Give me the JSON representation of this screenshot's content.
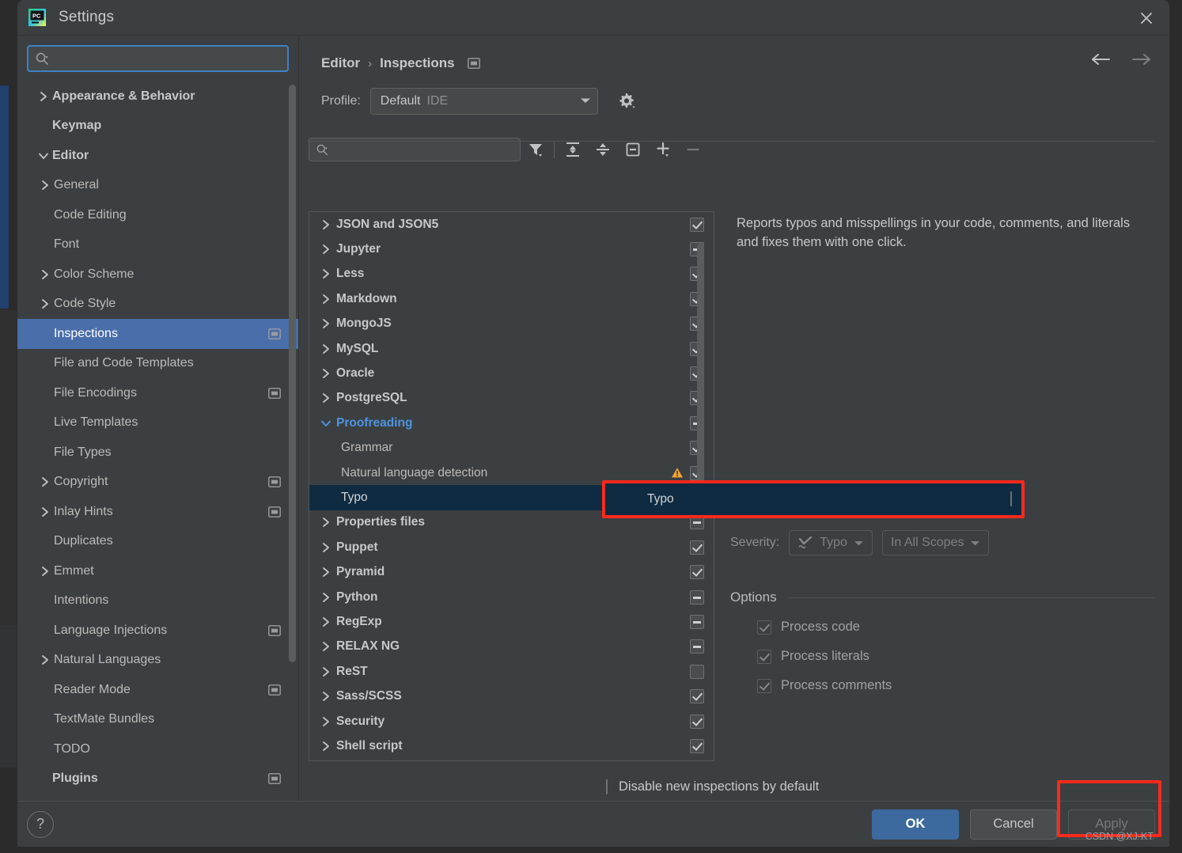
{
  "window": {
    "title": "Settings",
    "logo_icon": "pycharm-logo-icon",
    "close_icon": "close-icon"
  },
  "sidebar": {
    "search": {
      "placeholder": "",
      "value": "",
      "icon": "search-icon"
    },
    "items": [
      {
        "label": "Appearance & Behavior",
        "indent": 0,
        "twisty": "chevron-right",
        "bold": true,
        "selected": false,
        "badge": ""
      },
      {
        "label": "Keymap",
        "indent": 0,
        "twisty": "",
        "bold": true,
        "selected": false,
        "badge": ""
      },
      {
        "label": "Editor",
        "indent": 0,
        "twisty": "chevron-down",
        "bold": true,
        "selected": false,
        "badge": ""
      },
      {
        "label": "General",
        "indent": 1,
        "twisty": "chevron-right",
        "bold": false,
        "selected": false,
        "badge": ""
      },
      {
        "label": "Code Editing",
        "indent": 1,
        "twisty": "",
        "bold": false,
        "selected": false,
        "badge": ""
      },
      {
        "label": "Font",
        "indent": 1,
        "twisty": "",
        "bold": false,
        "selected": false,
        "badge": ""
      },
      {
        "label": "Color Scheme",
        "indent": 1,
        "twisty": "chevron-right",
        "bold": false,
        "selected": false,
        "badge": ""
      },
      {
        "label": "Code Style",
        "indent": 1,
        "twisty": "chevron-right",
        "bold": false,
        "selected": false,
        "badge": ""
      },
      {
        "label": "Inspections",
        "indent": 1,
        "twisty": "",
        "bold": false,
        "selected": true,
        "badge": "project-scope-icon"
      },
      {
        "label": "File and Code Templates",
        "indent": 1,
        "twisty": "",
        "bold": false,
        "selected": false,
        "badge": ""
      },
      {
        "label": "File Encodings",
        "indent": 1,
        "twisty": "",
        "bold": false,
        "selected": false,
        "badge": "project-scope-icon"
      },
      {
        "label": "Live Templates",
        "indent": 1,
        "twisty": "",
        "bold": false,
        "selected": false,
        "badge": ""
      },
      {
        "label": "File Types",
        "indent": 1,
        "twisty": "",
        "bold": false,
        "selected": false,
        "badge": ""
      },
      {
        "label": "Copyright",
        "indent": 1,
        "twisty": "chevron-right",
        "bold": false,
        "selected": false,
        "badge": "project-scope-icon"
      },
      {
        "label": "Inlay Hints",
        "indent": 1,
        "twisty": "chevron-right",
        "bold": false,
        "selected": false,
        "badge": "project-scope-icon"
      },
      {
        "label": "Duplicates",
        "indent": 1,
        "twisty": "",
        "bold": false,
        "selected": false,
        "badge": ""
      },
      {
        "label": "Emmet",
        "indent": 1,
        "twisty": "chevron-right",
        "bold": false,
        "selected": false,
        "badge": ""
      },
      {
        "label": "Intentions",
        "indent": 1,
        "twisty": "",
        "bold": false,
        "selected": false,
        "badge": ""
      },
      {
        "label": "Language Injections",
        "indent": 1,
        "twisty": "",
        "bold": false,
        "selected": false,
        "badge": "project-scope-icon"
      },
      {
        "label": "Natural Languages",
        "indent": 1,
        "twisty": "chevron-right",
        "bold": false,
        "selected": false,
        "badge": ""
      },
      {
        "label": "Reader Mode",
        "indent": 1,
        "twisty": "",
        "bold": false,
        "selected": false,
        "badge": "project-scope-icon"
      },
      {
        "label": "TextMate Bundles",
        "indent": 1,
        "twisty": "",
        "bold": false,
        "selected": false,
        "badge": ""
      },
      {
        "label": "TODO",
        "indent": 1,
        "twisty": "",
        "bold": false,
        "selected": false,
        "badge": ""
      },
      {
        "label": "Plugins",
        "indent": 0,
        "twisty": "",
        "bold": true,
        "selected": false,
        "badge": "project-scope-icon"
      }
    ]
  },
  "main": {
    "breadcrumb": {
      "parent": "Editor",
      "separator": "›",
      "current": "Inspections",
      "badge_icon": "project-scope-icon"
    },
    "nav": {
      "back_icon": "arrow-left-icon",
      "forward_icon": "arrow-right-icon"
    },
    "profile": {
      "label": "Profile:",
      "value": "Default",
      "scope": "IDE",
      "caret_icon": "chevron-down-icon",
      "gear_icon": "gear-icon"
    },
    "toolbar": {
      "search": {
        "placeholder": "",
        "value": "",
        "icon": "search-icon"
      },
      "buttons": [
        {
          "name": "filter-icon",
          "title": "Filter inspections",
          "disabled": false
        },
        {
          "name": "expand-all-icon",
          "title": "Expand All",
          "disabled": false
        },
        {
          "name": "collapse-all-icon",
          "title": "Collapse All",
          "disabled": false
        },
        {
          "name": "reset-icon",
          "title": "Reset to Defaults",
          "disabled": false
        },
        {
          "name": "add-icon",
          "title": "Add",
          "disabled": false
        },
        {
          "name": "remove-icon",
          "title": "Remove",
          "disabled": true
        }
      ]
    },
    "inspection_tree": [
      {
        "label": "JSON and JSON5",
        "level": 0,
        "state": "checked",
        "expanded": false,
        "warning": false,
        "selected": false
      },
      {
        "label": "Jupyter",
        "level": 0,
        "state": "partial",
        "expanded": false,
        "warning": false,
        "selected": false
      },
      {
        "label": "Less",
        "level": 0,
        "state": "checked",
        "expanded": false,
        "warning": false,
        "selected": false
      },
      {
        "label": "Markdown",
        "level": 0,
        "state": "checked",
        "expanded": false,
        "warning": false,
        "selected": false
      },
      {
        "label": "MongoJS",
        "level": 0,
        "state": "checked",
        "expanded": false,
        "warning": false,
        "selected": false
      },
      {
        "label": "MySQL",
        "level": 0,
        "state": "checked",
        "expanded": false,
        "warning": false,
        "selected": false
      },
      {
        "label": "Oracle",
        "level": 0,
        "state": "checked",
        "expanded": false,
        "warning": false,
        "selected": false
      },
      {
        "label": "PostgreSQL",
        "level": 0,
        "state": "checked",
        "expanded": false,
        "warning": false,
        "selected": false
      },
      {
        "label": "Proofreading",
        "level": 0,
        "state": "partial",
        "expanded": true,
        "warning": false,
        "selected": false
      },
      {
        "label": "Grammar",
        "level": 1,
        "state": "checked",
        "expanded": false,
        "warning": false,
        "selected": false
      },
      {
        "label": "Natural language detection",
        "level": 1,
        "state": "checked",
        "expanded": false,
        "warning": true,
        "selected": false
      },
      {
        "label": "Typo",
        "level": 1,
        "state": "empty",
        "expanded": false,
        "warning": false,
        "selected": true
      },
      {
        "label": "Properties files",
        "level": 0,
        "state": "partial",
        "expanded": false,
        "warning": false,
        "selected": false
      },
      {
        "label": "Puppet",
        "level": 0,
        "state": "checked",
        "expanded": false,
        "warning": false,
        "selected": false
      },
      {
        "label": "Pyramid",
        "level": 0,
        "state": "checked",
        "expanded": false,
        "warning": false,
        "selected": false
      },
      {
        "label": "Python",
        "level": 0,
        "state": "partial",
        "expanded": false,
        "warning": false,
        "selected": false
      },
      {
        "label": "RegExp",
        "level": 0,
        "state": "partial",
        "expanded": false,
        "warning": false,
        "selected": false
      },
      {
        "label": "RELAX NG",
        "level": 0,
        "state": "partial",
        "expanded": false,
        "warning": false,
        "selected": false
      },
      {
        "label": "ReST",
        "level": 0,
        "state": "empty",
        "expanded": false,
        "warning": false,
        "selected": false
      },
      {
        "label": "Sass/SCSS",
        "level": 0,
        "state": "checked",
        "expanded": false,
        "warning": false,
        "selected": false
      },
      {
        "label": "Security",
        "level": 0,
        "state": "checked",
        "expanded": false,
        "warning": false,
        "selected": false
      },
      {
        "label": "Shell script",
        "level": 0,
        "state": "checked",
        "expanded": false,
        "warning": false,
        "selected": false
      }
    ],
    "description": "Reports typos and misspellings in your code, comments, and literals and fixes them with one click.",
    "severity": {
      "label": "Severity:",
      "value": "Typo",
      "icon": "typo-squiggle-icon",
      "caret_icon": "chevron-down-icon",
      "scope_value": "In All Scopes",
      "scope_caret_icon": "chevron-down-icon",
      "disabled": true
    },
    "options": {
      "title": "Options",
      "items": [
        {
          "label": "Process code",
          "checked": true,
          "disabled": true
        },
        {
          "label": "Process literals",
          "checked": true,
          "disabled": true
        },
        {
          "label": "Process comments",
          "checked": true,
          "disabled": true
        }
      ]
    },
    "disable_new_inspections": {
      "label": "Disable new inspections by default",
      "checked": false
    }
  },
  "footer": {
    "help_label": "?",
    "ok_label": "OK",
    "cancel_label": "Cancel",
    "apply_label": "Apply",
    "apply_disabled": true
  },
  "watermark": "CSDN @XJ-KT",
  "colors": {
    "dialog_bg": "#3c3f41",
    "sidebar_selection": "#4a6ea9",
    "tree_selection": "#0e2b42",
    "highlight_red": "#fc2a1c",
    "accent_blue": "#4e93e0",
    "ok_button": "#3c6a9e",
    "warning_amber": "#f0a732"
  }
}
